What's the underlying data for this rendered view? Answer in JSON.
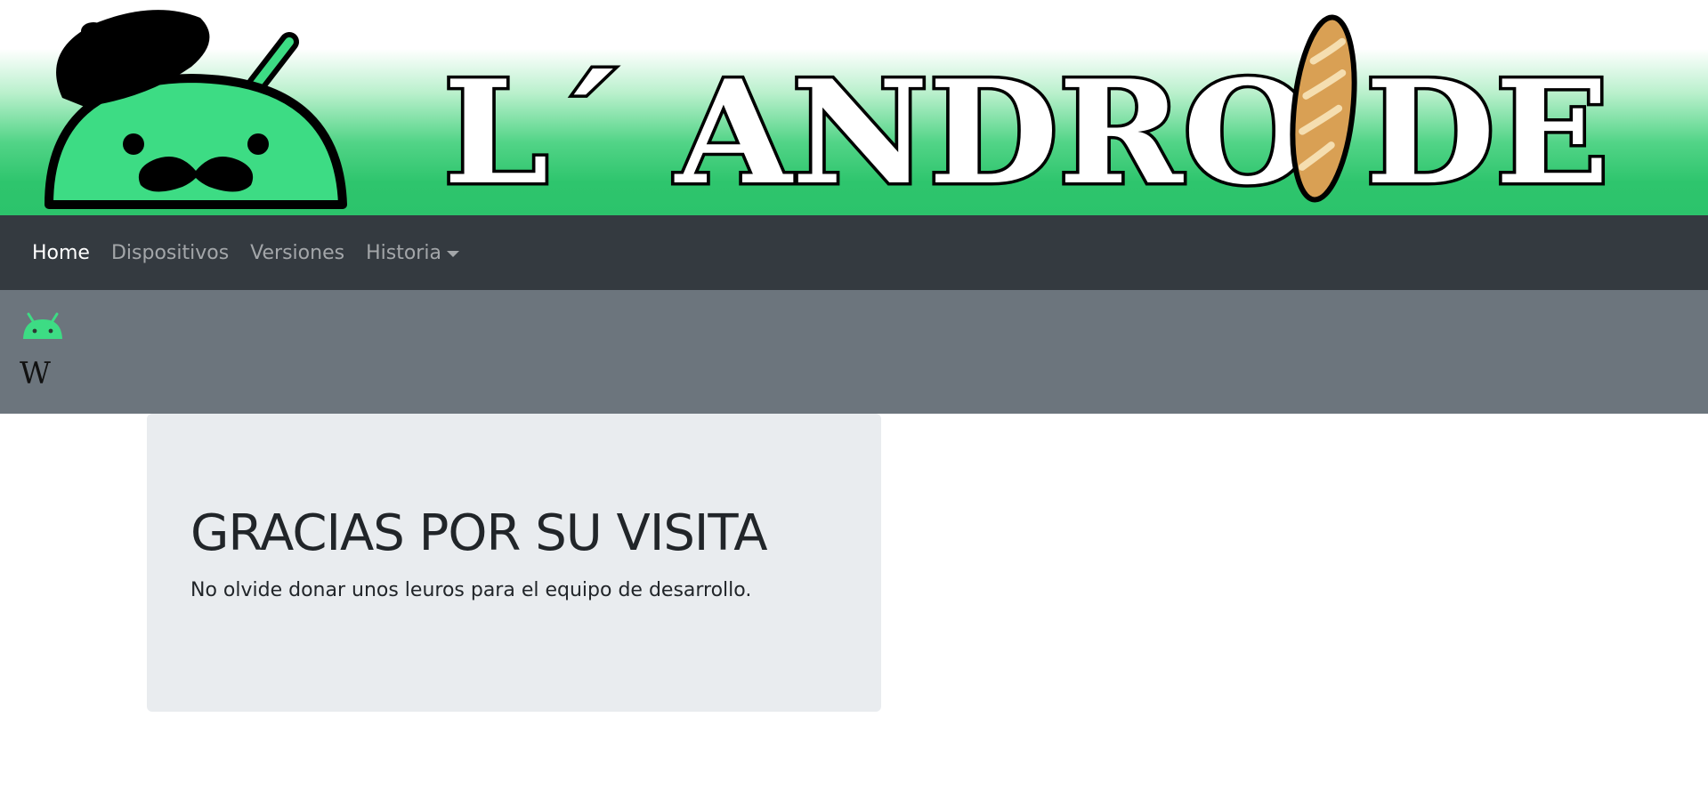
{
  "banner": {
    "brand_text": "L´ ANDRO DE",
    "logo_icon": "android-mascot-beret-mustache-icon",
    "baguette_icon": "baguette-icon"
  },
  "navbar": {
    "items": [
      {
        "label": "Home",
        "active": true
      },
      {
        "label": "Dispositivos",
        "active": false
      },
      {
        "label": "Versiones",
        "active": false
      },
      {
        "label": "Historia",
        "active": false,
        "dropdown": true
      }
    ]
  },
  "icon_strip": {
    "android_icon": "android-head-icon",
    "wiki_label": "W"
  },
  "jumbotron": {
    "title": "GRACIAS POR SU VISITA",
    "lead": "No olvide donar unos leuros para el equipo de desarrollo."
  },
  "colors": {
    "banner_green": "#2cc36b",
    "android_green": "#3ddc84",
    "navbar_bg": "#343a40",
    "strip_bg": "#6c757d",
    "jumbotron_bg": "#e9ecef"
  }
}
